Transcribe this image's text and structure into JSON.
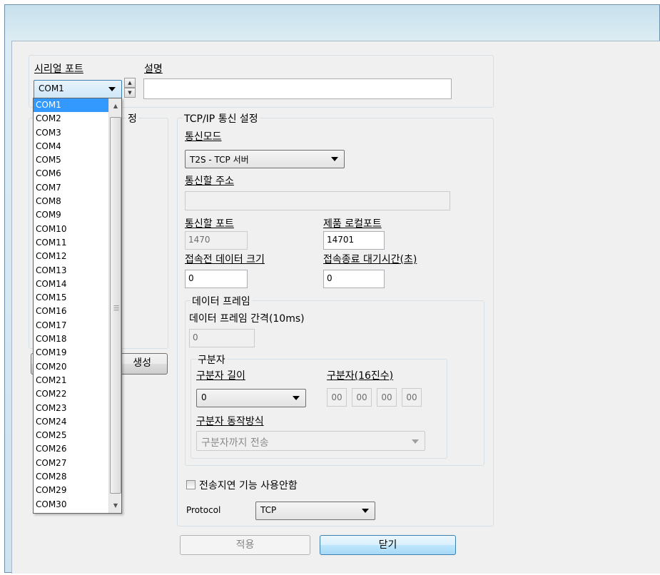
{
  "serial": {
    "port_label": "시리얼 포트",
    "desc_label": "설명",
    "selected_port": "COM1",
    "description_value": ""
  },
  "left_panel": {
    "partial_title": "정",
    "partial_button": "생성"
  },
  "tcp": {
    "group_title": "TCP/IP 통신 설정",
    "mode_label": "통신모드",
    "mode_value": "T2S - TCP 서버",
    "address_label": "통신할 주소",
    "address_value": "",
    "remote_port_label": "통신할 포트",
    "remote_port_value": "1470",
    "local_port_label": "제품 로컬포트",
    "local_port_value": "14701",
    "pre_data_label": "접속전 데이터 크기",
    "pre_data_value": "0",
    "close_wait_label": "접속종료 대기시간(초)",
    "close_wait_value": "0"
  },
  "frame": {
    "group_title": "데이터 프레임",
    "interval_label": "데이터 프레임 간격(10ms)",
    "interval_value": "0",
    "delimiter_group_title": "구분자",
    "delim_len_label": "구분자 길이",
    "delim_len_value": "0",
    "delim_hex_label": "구분자(16진수)",
    "delim_hex_values": [
      "00",
      "00",
      "00",
      "00"
    ],
    "delim_mode_label": "구분자 동작방식",
    "delim_mode_value": "구분자까지 전송"
  },
  "options": {
    "no_delay_label": "전송지연 기능 사용안함",
    "no_delay_checked": false,
    "protocol_label": "Protocol",
    "protocol_value": "TCP"
  },
  "buttons": {
    "apply": "적용",
    "close": "닫기"
  },
  "dropdown": {
    "items": [
      "COM1",
      "COM2",
      "COM3",
      "COM4",
      "COM5",
      "COM6",
      "COM7",
      "COM8",
      "COM9",
      "COM10",
      "COM11",
      "COM12",
      "COM13",
      "COM14",
      "COM15",
      "COM16",
      "COM17",
      "COM18",
      "COM19",
      "COM20",
      "COM21",
      "COM22",
      "COM23",
      "COM24",
      "COM25",
      "COM26",
      "COM27",
      "COM28",
      "COM29",
      "COM30"
    ],
    "selected_index": 0
  },
  "colors": {
    "selection": "#3399ff",
    "title_bar": "#c7e1ed",
    "client_bg": "#f0f0f0"
  }
}
